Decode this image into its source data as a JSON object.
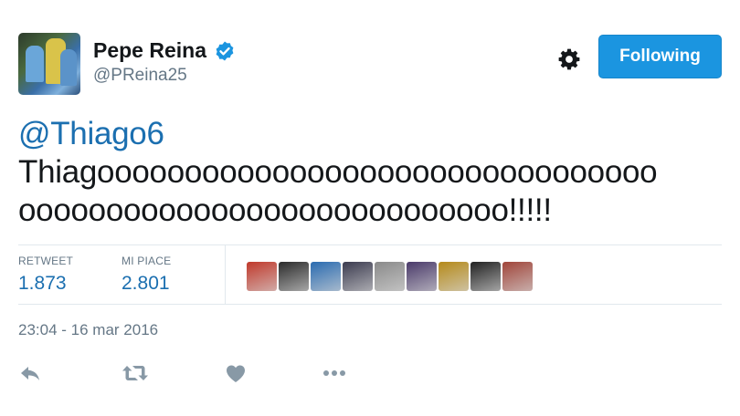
{
  "user": {
    "name": "Pepe Reina",
    "handle": "@PReina25",
    "verified": true
  },
  "follow_button": {
    "label": "Following"
  },
  "tweet": {
    "mention": "@Thiago6",
    "line1": "Thiagoooooooooooooooooooooooooooooooo",
    "line2": "oooooooooooooooooooooooooooo!!!!!"
  },
  "stats": {
    "retweet_label": "RETWEET",
    "retweet_count": "1.873",
    "like_label": "MI PIACE",
    "like_count": "2.801"
  },
  "likers": [
    {
      "name": "liker-avatar",
      "color": "#c0392b"
    },
    {
      "name": "liker-avatar",
      "color": "#2b2b2b"
    },
    {
      "name": "liker-avatar",
      "color": "#2a6bb0"
    },
    {
      "name": "liker-avatar",
      "color": "#3b3b4f"
    },
    {
      "name": "liker-avatar",
      "color": "#8a8a8a"
    },
    {
      "name": "liker-avatar",
      "color": "#4a3a6a"
    },
    {
      "name": "liker-avatar",
      "color": "#b58a1a"
    },
    {
      "name": "liker-avatar",
      "color": "#222222"
    },
    {
      "name": "liker-avatar",
      "color": "#a0453a"
    }
  ],
  "timestamp": "23:04 - 16 mar 2016",
  "actions": [
    "reply-icon",
    "retweet-icon",
    "like-icon",
    "more-icon"
  ],
  "colors": {
    "accent": "#1b95e0",
    "link": "#1b6fb0",
    "muted": "#657786",
    "icon": "#8899a6"
  }
}
